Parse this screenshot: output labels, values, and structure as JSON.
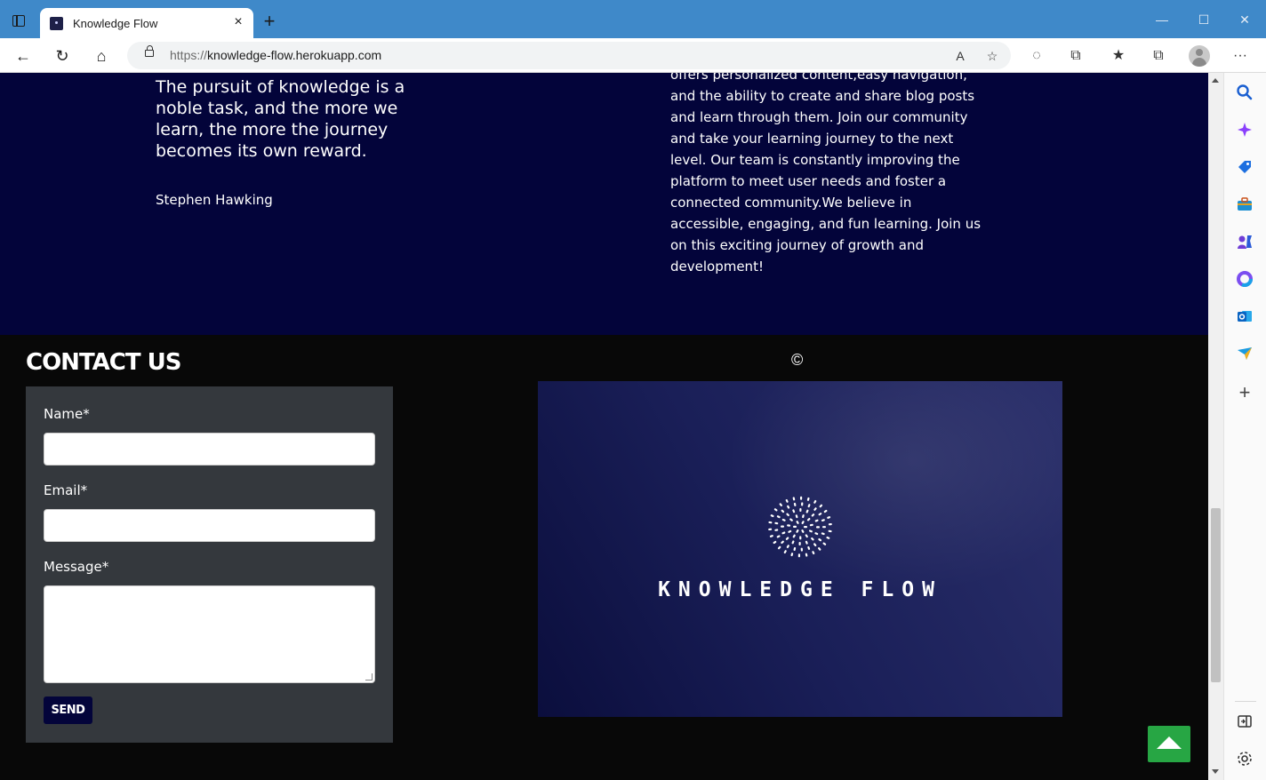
{
  "browser": {
    "tab_title": "Knowledge Flow",
    "tab_close": "×",
    "new_tab": "+",
    "url_protocol": "https://",
    "url_host": "knowledge-flow.herokuapp.com",
    "window_controls": {
      "minimize": "—",
      "maximize": "☐",
      "close": "✕"
    },
    "nav": {
      "back": "←",
      "reload": "↻",
      "home": "⌂"
    },
    "toolbar": {
      "read_aloud": "A",
      "favorite": "☆",
      "extensions": "⧉",
      "favorites": "★",
      "collections": "⧉",
      "more": "···"
    }
  },
  "about": {
    "quote": "The pursuit of knowledge is a noble task, and the more we learn, the more the journey becomes its own reward.",
    "author": "Stephen Hawking",
    "description_lines": [
      "offers personalized content,easy navigation,",
      "and the ability to create and share blog posts",
      "and learn through them. Join our community",
      "and take your learning journey to the next",
      "level. Our team is constantly improving the",
      "platform to meet user needs and foster a",
      "connected community.We believe in",
      "accessible, engaging, and fun learning. Join us",
      "on this exciting journey of growth and",
      "development!"
    ]
  },
  "contact": {
    "title": "CONTACT US",
    "name_label": "Name*",
    "email_label": "Email*",
    "message_label": "Message*",
    "send_label": "SEND",
    "copyright": "©"
  },
  "brand": {
    "name": "KNOWLEDGE FLOW"
  },
  "colors": {
    "about_bg": "#03043a",
    "contact_bg": "#080808",
    "form_bg": "#34383d",
    "send_bg": "#03043a",
    "back_to_top_bg": "#27a644",
    "titlebar": "#3f89c9"
  },
  "icons": {
    "sidebar": [
      "search-icon",
      "copilot-icon",
      "shopping-tag-icon",
      "toolbox-icon",
      "games-icon",
      "office-icon",
      "outlook-icon",
      "send-icon",
      "add-icon",
      "split-screen-icon",
      "settings-icon"
    ]
  }
}
